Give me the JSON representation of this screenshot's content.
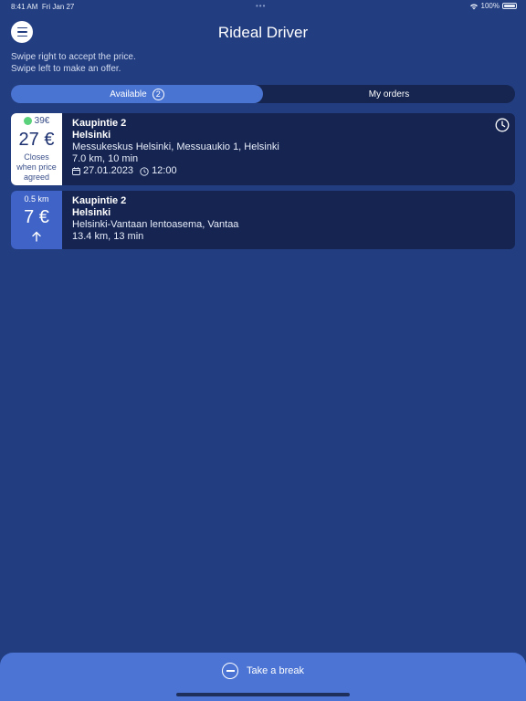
{
  "status_bar": {
    "time": "8:41 AM",
    "date": "Fri Jan 27",
    "battery": "100%"
  },
  "header": {
    "title": "Rideal Driver",
    "menu_icon": "hamburger-menu-icon"
  },
  "hints": [
    "Swipe right to accept the price.",
    "Swipe left to make an offer."
  ],
  "tabs": [
    {
      "label": "Available",
      "count": "2",
      "active": true
    },
    {
      "label": "My orders",
      "active": false
    }
  ],
  "orders": [
    {
      "offer": "39€",
      "price": "27 €",
      "note_lines": [
        "Closes",
        "when price",
        "agreed"
      ],
      "from": "Kaupintie 2",
      "city": "Helsinki",
      "to": "Messukeskus Helsinki, Messuaukio 1, Helsinki",
      "distance_time": "7.0 km, 10 min",
      "date": "27.01.2023",
      "time": "12:00"
    },
    {
      "distance_away": "0.5 km",
      "price": "7 €",
      "from": "Kaupintie 2",
      "city": "Helsinki",
      "to": "Helsinki-Vantaan lentoasema, Vantaa",
      "distance_time": "13.4 km, 13 min"
    }
  ],
  "footer": {
    "break_label": "Take a break"
  },
  "colors": {
    "background": "#223d80",
    "accent": "#4a74d2",
    "card": "#152450",
    "offer_dot": "#5ad17b"
  }
}
